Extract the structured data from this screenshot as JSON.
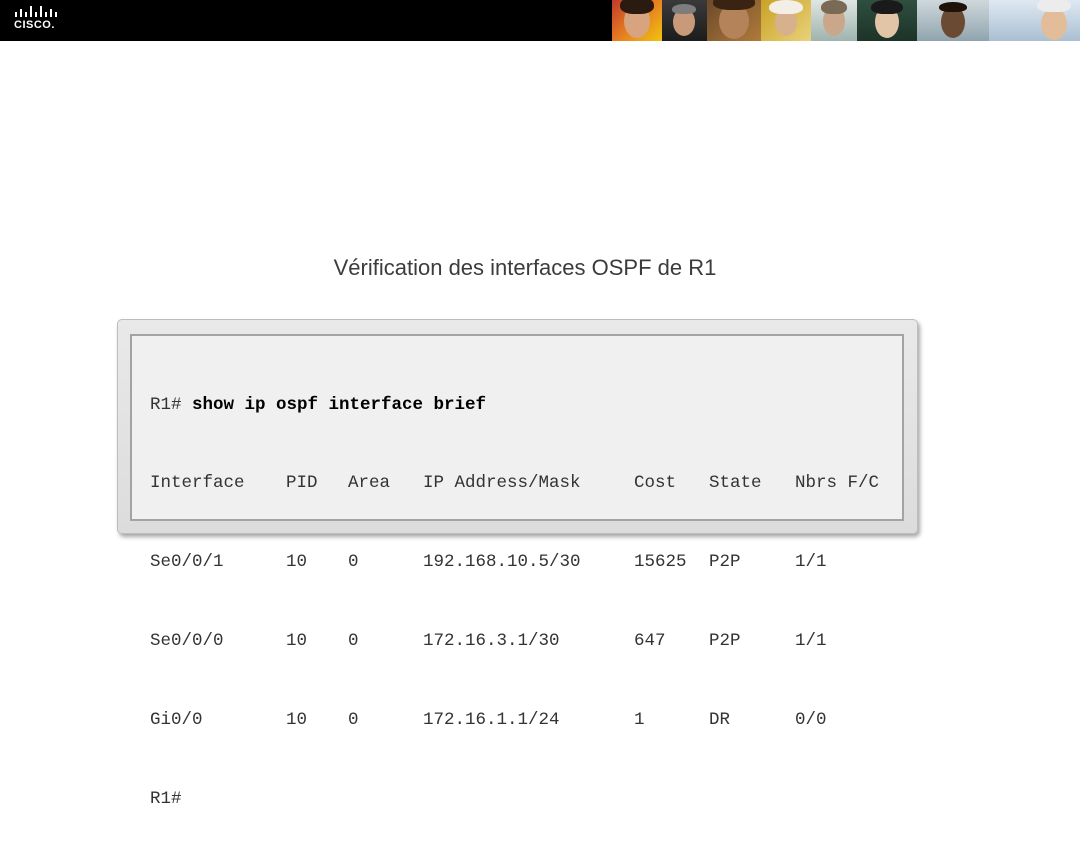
{
  "header": {
    "logo_text": "CISCO."
  },
  "slide": {
    "title": "Vérification des interfaces OSPF de R1"
  },
  "terminal": {
    "prompt": "R1# ",
    "command": "show ip ospf interface brief",
    "columns": [
      "Interface",
      "PID",
      "Area",
      "IP Address/Mask",
      "Cost",
      "State",
      "Nbrs F/C"
    ],
    "rows": [
      [
        "Se0/0/1",
        "10",
        "0",
        "192.168.10.5/30",
        "15625",
        "P2P",
        "1/1"
      ],
      [
        "Se0/0/0",
        "10",
        "0",
        "172.16.3.1/30",
        "647",
        "P2P",
        "1/1"
      ],
      [
        "Gi0/0",
        "10",
        "0",
        "172.16.1.1/24",
        "1",
        "DR",
        "0/0"
      ]
    ],
    "end_prompt": "R1#"
  }
}
